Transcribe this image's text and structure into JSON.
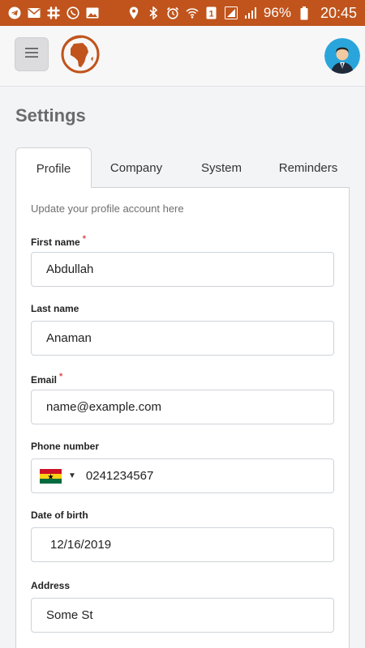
{
  "status_bar": {
    "battery_percent": "96%",
    "time": "20:45",
    "left_icons": [
      "telegram-icon",
      "mail-icon",
      "slack-icon",
      "whatsapp-icon",
      "image-icon"
    ],
    "right_icons": [
      "location-icon",
      "bluetooth-icon",
      "alarm-icon",
      "wifi-icon",
      "sim-1-icon",
      "signal-icon",
      "battery-icon"
    ],
    "accent_color": "#c0541c"
  },
  "header": {
    "menu_icon": "hamburger-menu-icon",
    "logo_icon": "globe-africa-logo-icon",
    "avatar_icon": "user-avatar-icon"
  },
  "page": {
    "title": "Settings"
  },
  "tabs": [
    {
      "label": "Profile",
      "active": true
    },
    {
      "label": "Company",
      "active": false
    },
    {
      "label": "System",
      "active": false
    },
    {
      "label": "Reminders",
      "active": false
    }
  ],
  "profile_form": {
    "subtitle": "Update your profile account here",
    "first_name": {
      "label": "First name",
      "required": "*",
      "value": "Abdullah"
    },
    "last_name": {
      "label": "Last name",
      "value": "Anaman"
    },
    "email": {
      "label": "Email",
      "required": "*",
      "value": "name@example.com"
    },
    "phone": {
      "label": "Phone number",
      "country_flag": "ghana-flag-icon",
      "value": "0241234567"
    },
    "date_of_birth": {
      "label": "Date of birth",
      "value": "12/16/2019"
    },
    "address": {
      "label": "Address",
      "value": "Some St"
    }
  }
}
